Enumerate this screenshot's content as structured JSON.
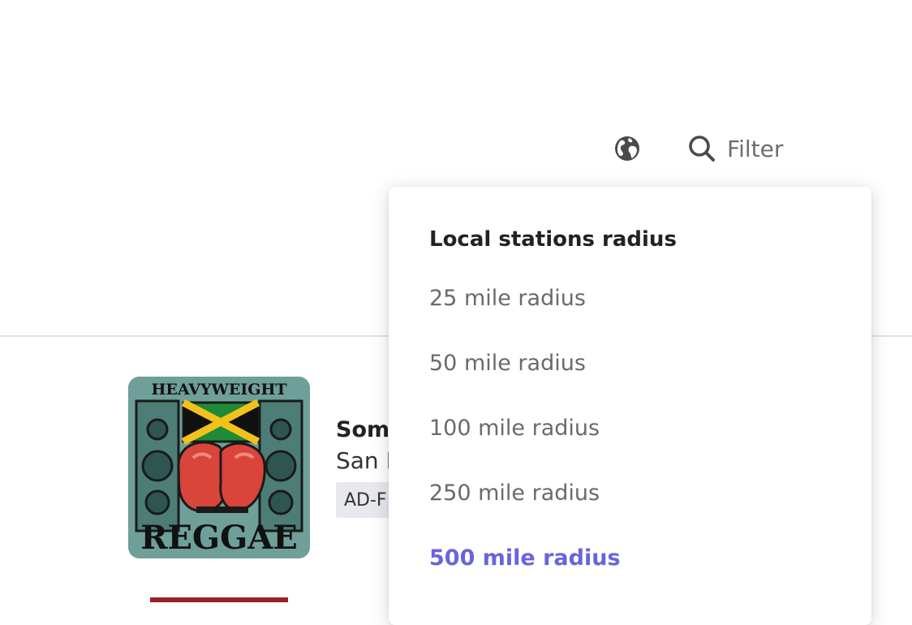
{
  "toolbar": {
    "globe_icon": "globe-icon",
    "search_icon": "search-icon",
    "filter_placeholder": "Filter"
  },
  "station": {
    "artwork_text_top": "HEAVYWEIGHT",
    "artwork_text_bottom": "REGGAE",
    "name": "Soma",
    "location": "San F",
    "tag": "AD-F"
  },
  "radius_menu": {
    "title": "Local stations radius",
    "options": [
      {
        "label": "25 mile radius",
        "selected": false
      },
      {
        "label": "50 mile radius",
        "selected": false
      },
      {
        "label": "100 mile radius",
        "selected": false
      },
      {
        "label": "250 mile radius",
        "selected": false
      },
      {
        "label": "500 mile radius",
        "selected": true
      }
    ]
  },
  "colors": {
    "accent": "#6a64db",
    "artwork_bg": "#6f9f99",
    "glove_red": "#d9443b",
    "tag_bg": "#e7e9ef",
    "next_card": "#9b2127"
  }
}
